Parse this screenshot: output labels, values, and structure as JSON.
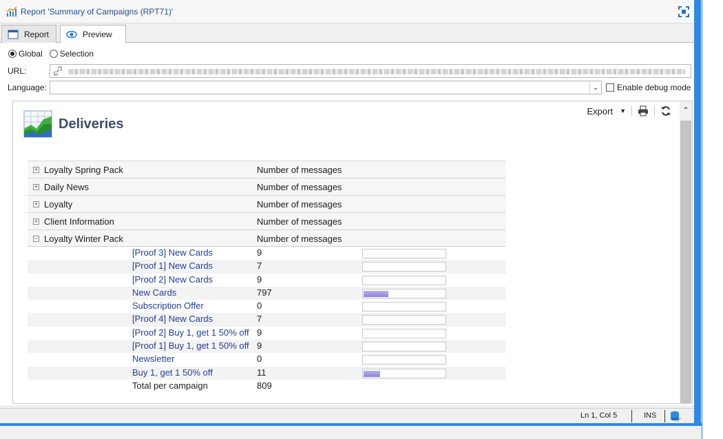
{
  "window": {
    "title": "Report 'Summary of Campaigns (RPT71)'"
  },
  "tabs": [
    {
      "label": "Report",
      "icon": "window-icon"
    },
    {
      "label": "Preview",
      "icon": "eye-icon"
    }
  ],
  "mode": {
    "global_label": "Global",
    "selection_label": "Selection",
    "selected": "Global"
  },
  "url_label": "URL:",
  "language_label": "Language:",
  "language_value": "",
  "debug_label": "Enable debug mode",
  "report": {
    "export_label": "Export",
    "heading": "Deliveries",
    "groups": [
      {
        "name": "Loyalty Spring Pack",
        "col": "Number of messages",
        "expanded": false
      },
      {
        "name": "Daily News",
        "col": "Number of messages",
        "expanded": false
      },
      {
        "name": "Loyalty",
        "col": "Number of messages",
        "expanded": false
      },
      {
        "name": "Client Information",
        "col": "Number of messages",
        "expanded": false
      },
      {
        "name": "Loyalty Winter Pack",
        "col": "Number of messages",
        "expanded": true
      }
    ],
    "rows": [
      {
        "name": "[Proof 3] New Cards",
        "value": "9",
        "share": 0.0
      },
      {
        "name": "[Proof 1] New Cards",
        "value": "7",
        "share": 0.0
      },
      {
        "name": "[Proof 2] New Cards",
        "value": "9",
        "share": 0.0
      },
      {
        "name": "New Cards",
        "value": "797",
        "share": 0.3
      },
      {
        "name": "Subscription Offer",
        "value": "0",
        "share": 0.0
      },
      {
        "name": "[Proof 4] New Cards",
        "value": "7",
        "share": 0.0
      },
      {
        "name": "[Proof 2] Buy 1, get 1 50% off",
        "value": "9",
        "share": 0.0
      },
      {
        "name": "[Proof 1] Buy 1, get 1 50% off",
        "value": "9",
        "share": 0.0
      },
      {
        "name": "Newsletter",
        "value": "0",
        "share": 0.0
      },
      {
        "name": "Buy 1, get 1 50% off",
        "value": "11",
        "share": 0.2
      }
    ],
    "total": {
      "name": "Total per campaign",
      "value": "809"
    }
  },
  "status": {
    "position": "Ln 1, Col 5",
    "mode": "INS"
  }
}
